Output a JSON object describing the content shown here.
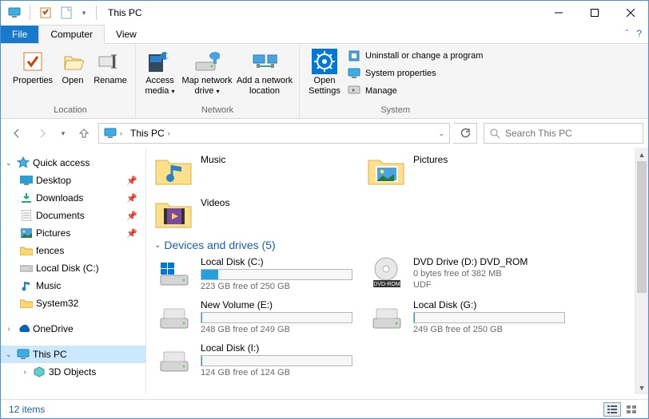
{
  "window": {
    "title": "This PC"
  },
  "win_controls": {
    "min": "minimize",
    "max": "maximize",
    "close": "close"
  },
  "tabs": {
    "file": "File",
    "computer": "Computer",
    "view": "View"
  },
  "ribbon": {
    "location": {
      "label": "Location",
      "properties": "Properties",
      "open": "Open",
      "rename": "Rename"
    },
    "network": {
      "label": "Network",
      "access_media": "Access media",
      "map_drive": "Map network drive",
      "add_location": "Add a network location"
    },
    "system": {
      "label": "System",
      "open_settings": "Open Settings",
      "uninstall": "Uninstall or change a program",
      "sysprops": "System properties",
      "manage": "Manage"
    }
  },
  "nav": {
    "location": "This PC",
    "search_placeholder": "Search This PC"
  },
  "tree": {
    "quick_access": "Quick access",
    "desktop": "Desktop",
    "downloads": "Downloads",
    "documents": "Documents",
    "pictures": "Pictures",
    "fences": "fences",
    "local_c": "Local Disk (C:)",
    "music": "Music",
    "system32": "System32",
    "onedrive": "OneDrive",
    "this_pc": "This PC",
    "objects3d": "3D Objects"
  },
  "folders": {
    "music": "Music",
    "pictures": "Pictures",
    "videos": "Videos"
  },
  "section": {
    "devices": "Devices and drives (5)"
  },
  "drives": [
    {
      "name": "Local Disk (C:)",
      "free_text": "223 GB free of 250 GB",
      "used_pct": 11,
      "type": "win"
    },
    {
      "name": "DVD Drive (D:) DVD_ROM",
      "free_text": "0 bytes free of 382 MB",
      "fs": "UDF",
      "type": "dvd"
    },
    {
      "name": "New Volume (E:)",
      "free_text": "248 GB free of 249 GB",
      "used_pct": 0.5,
      "type": "hdd"
    },
    {
      "name": "Local Disk (G:)",
      "free_text": "249 GB free of 250 GB",
      "used_pct": 0.5,
      "type": "hdd"
    },
    {
      "name": "Local Disk (I:)",
      "free_text": "124 GB free of 124 GB",
      "used_pct": 0.5,
      "type": "hdd"
    }
  ],
  "status": {
    "items": "12 items"
  },
  "colors": {
    "accent": "#1979ca",
    "bar_fill": "#26a0da",
    "link": "#1a5fb4"
  }
}
